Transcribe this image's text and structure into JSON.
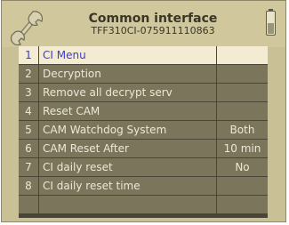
{
  "header": {
    "title": "Common interface",
    "subtitle": "TFF310CI-075911110863"
  },
  "icons": {
    "header_icon": "wrench-icon",
    "status_icon": "battery-icon"
  },
  "colors": {
    "background": "#c9c095",
    "row": "#7b755b",
    "row_selected": "#f3ecd3",
    "selected_text": "#3b3bd6",
    "text": "#ece8d6"
  },
  "menu": {
    "selected_index": 0,
    "items": [
      {
        "number": "1",
        "label": "CI Menu",
        "value": ""
      },
      {
        "number": "2",
        "label": "Decryption",
        "value": ""
      },
      {
        "number": "3",
        "label": "Remove all decrypt serv",
        "value": ""
      },
      {
        "number": "4",
        "label": "Reset CAM",
        "value": ""
      },
      {
        "number": "5",
        "label": "CAM Watchdog System",
        "value": "Both"
      },
      {
        "number": "6",
        "label": "CAM Reset After",
        "value": "10 min"
      },
      {
        "number": "7",
        "label": "CI daily reset",
        "value": "No"
      },
      {
        "number": "8",
        "label": "CI daily reset time",
        "value": ""
      },
      {
        "number": "",
        "label": "",
        "value": ""
      }
    ]
  }
}
